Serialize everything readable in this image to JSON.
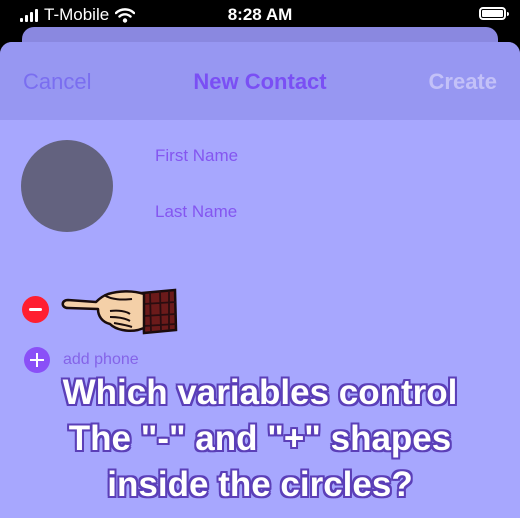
{
  "status_bar": {
    "carrier": "T-Mobile",
    "time": "8:28 AM",
    "icons": [
      "signal-bars-icon",
      "wifi-icon",
      "battery-icon"
    ]
  },
  "nav": {
    "cancel_label": "Cancel",
    "title": "New Contact",
    "create_label": "Create"
  },
  "form": {
    "first_name_placeholder": "First Name",
    "last_name_placeholder": "Last Name",
    "add_phone_label": "add phone",
    "icons": [
      "contact-avatar",
      "remove-phone-minus-icon",
      "add-phone-plus-icon",
      "pointing-hand-icon"
    ]
  },
  "caption": {
    "line1": "Which variables control",
    "line2": "The \"-\" and \"+\" shapes",
    "line3": "inside the circles?"
  },
  "colors": {
    "sheet_background": "#a7a7fe",
    "nav_background": "#9797f2",
    "title": "#7a4ff4",
    "minus_button": "#ff1f30",
    "plus_button": "#8a50f7"
  }
}
